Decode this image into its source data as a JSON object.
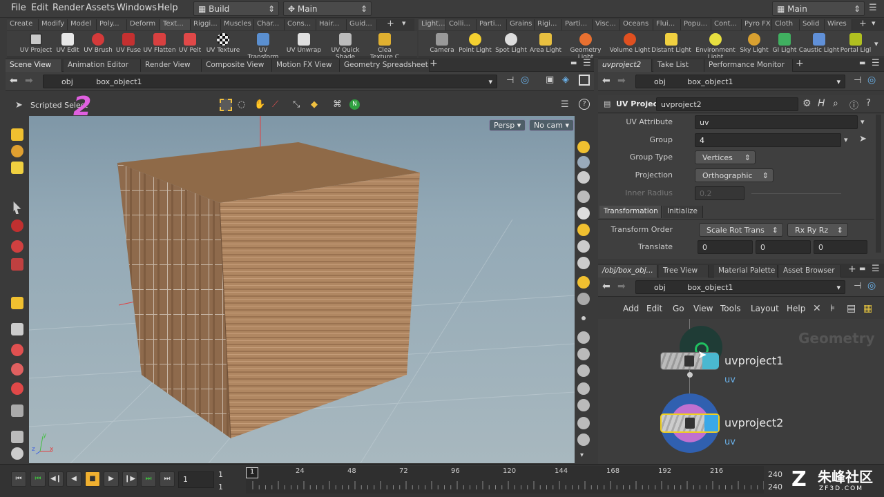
{
  "menubar": {
    "items": [
      "File",
      "Edit",
      "Render",
      "Assets",
      "Windows",
      "Help"
    ],
    "desktop": "Build",
    "workspace": "Main",
    "right_desktop": "Main"
  },
  "shelf_left": {
    "tabs": [
      "Create",
      "Modify",
      "Model",
      "Poly...",
      "Deform",
      "Text...",
      "Riggi...",
      "Muscles",
      "Char...",
      "Cons...",
      "Hair...",
      "Guid..."
    ],
    "tools": [
      "UV Project",
      "UV Edit",
      "UV Brush",
      "UV Fuse",
      "UV Flatten",
      "UV Pelt",
      "UV Texture",
      "UV Transform",
      "UV Unwrap",
      "UV Quick Shade",
      "Clea Texture C"
    ]
  },
  "shelf_right": {
    "tabs": [
      "Light...",
      "Colli...",
      "Parti...",
      "Grains",
      "Rigi...",
      "Parti...",
      "Visc...",
      "Oceans",
      "Flui...",
      "Popu...",
      "Cont...",
      "Pyro FX",
      "Cloth",
      "Solid",
      "Wires"
    ],
    "tools": [
      "Camera",
      "Point Light",
      "Spot Light",
      "Area Light",
      "Geometry Light",
      "Volume Light",
      "Distant Light",
      "Environment Light",
      "Sky Light",
      "GI Light",
      "Caustic Light",
      "Portal Ligl"
    ]
  },
  "viewer": {
    "tabs": [
      "Scene View",
      "Animation Editor",
      "Render View",
      "Composite View",
      "Motion FX View",
      "Geometry Spreadsheet"
    ],
    "path_root": "obj",
    "path_node": "box_object1",
    "tool_label": "Scripted Select",
    "overlay_digit": "2",
    "persp": "Persp",
    "cam": "No cam",
    "axis_x": "x",
    "axis_y": "y",
    "axis_z": "z"
  },
  "params": {
    "tabs": [
      "uvproject2",
      "Take List",
      "Performance Monitor"
    ],
    "path_root": "obj",
    "path_node": "box_object1",
    "node_type": "UV Project",
    "node_name": "uvproject2",
    "uv_attribute_label": "UV Attribute",
    "uv_attribute": "uv",
    "group_label": "Group",
    "group": "4",
    "group_type_label": "Group Type",
    "group_type": "Vertices",
    "projection_label": "Projection",
    "projection": "Orthographic",
    "inner_radius_label": "Inner Radius",
    "inner_radius": "0.2",
    "subtabs": [
      "Transformation",
      "Initialize"
    ],
    "transform_order_label": "Transform Order",
    "transform_order": "Scale Rot Trans",
    "rot_order": "Rx Ry Rz",
    "translate_label": "Translate",
    "translate": [
      "0",
      "0",
      "0"
    ]
  },
  "network": {
    "tabs": [
      "/obj/box_obj...",
      "Tree View",
      "Material Palette",
      "Asset Browser"
    ],
    "path_root": "obj",
    "path_node": "box_object1",
    "menu": [
      "Add",
      "Edit",
      "Go",
      "View",
      "Tools",
      "Layout",
      "Help"
    ],
    "context": "Geometry",
    "nodes": [
      {
        "name": "uvproject1",
        "sub": "uv"
      },
      {
        "name": "uvproject2",
        "sub": "uv"
      }
    ]
  },
  "timeline": {
    "frame": "1",
    "start": "1",
    "start2": "1",
    "end": "240",
    "end2": "240",
    "ticks": [
      "1",
      "24",
      "48",
      "72",
      "96",
      "120",
      "144",
      "168",
      "192",
      "216",
      "240"
    ]
  },
  "watermark": "朱峰社区",
  "watermark_url": "ZF3D.COM"
}
